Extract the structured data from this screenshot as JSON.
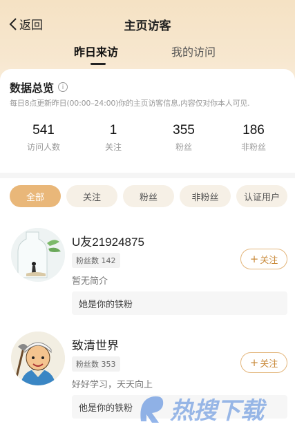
{
  "header": {
    "back_label": "返回",
    "title": "主页访客",
    "tabs": [
      {
        "label": "昨日来访",
        "active": true
      },
      {
        "label": "我的访问",
        "active": false
      }
    ]
  },
  "overview": {
    "title": "数据总览",
    "info_icon": "info-icon",
    "description": "每日8点更新昨日(00:00–24:00)你的主页访客信息,内容仅对你本人可见.",
    "stats": [
      {
        "value": "541",
        "label": "访问人数"
      },
      {
        "value": "1",
        "label": "关注"
      },
      {
        "value": "355",
        "label": "粉丝"
      },
      {
        "value": "186",
        "label": "非粉丝"
      }
    ]
  },
  "filters": [
    {
      "label": "全部",
      "active": true
    },
    {
      "label": "关注",
      "active": false
    },
    {
      "label": "粉丝",
      "active": false
    },
    {
      "label": "非粉丝",
      "active": false
    },
    {
      "label": "认证用户",
      "active": false
    }
  ],
  "visitors": [
    {
      "name": "U友21924875",
      "fans_label": "粉丝数",
      "fans_count": "142",
      "bio": "暂无简介",
      "tag": "她是你的铁粉",
      "follow_label": "关注"
    },
    {
      "name": "致清世界",
      "fans_label": "粉丝数",
      "fans_count": "353",
      "bio": "好好学习，天天向上",
      "tag": "他是你的铁粉",
      "follow_label": "关注"
    }
  ],
  "watermark": {
    "text": "热搜下载"
  },
  "colors": {
    "accent": "#e9b779",
    "follow_text": "#c98a3a",
    "chip_bg": "#f6f0e6",
    "hero_bg": "#f5e2c4"
  }
}
